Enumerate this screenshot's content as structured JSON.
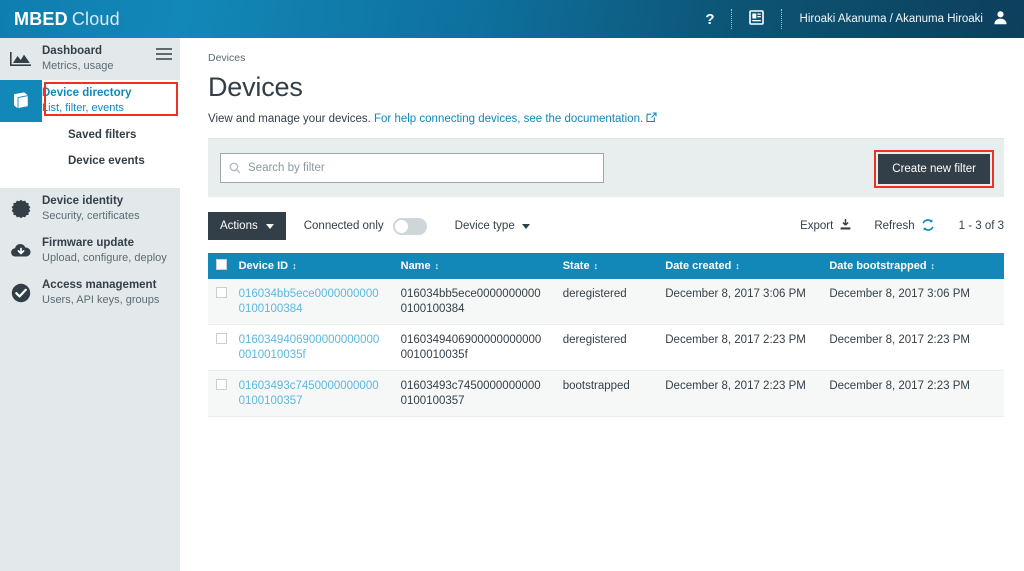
{
  "topbar": {
    "brand_bold": "MBED",
    "brand_light": "Cloud",
    "help_label": "?",
    "docs_icon": "book-contact-icon",
    "user_name": "Hiroaki Akanuma / Akanuma Hiroaki",
    "avatar_icon": "user-avatar-icon",
    "gradient_from": "#1288b8",
    "gradient_to": "#0c3f5c"
  },
  "sidebar": {
    "menu_icon": "hamburger-menu-icon",
    "items": [
      {
        "title": "Dashboard",
        "sub": "Metrics, usage",
        "icon": "chart-mountain-icon",
        "active": false
      },
      {
        "title": "Device directory",
        "sub": "List, filter, events",
        "icon": "book-icon",
        "active": true
      },
      {
        "title": "Device identity",
        "sub": "Security, certificates",
        "icon": "gear-badge-icon",
        "active": false
      },
      {
        "title": "Firmware update",
        "sub": "Upload, configure, deploy",
        "icon": "cloud-download-icon",
        "active": false
      },
      {
        "title": "Access management",
        "sub": "Users, API keys, groups",
        "icon": "check-circle-icon",
        "active": false
      }
    ],
    "sub_items": [
      {
        "label": "Saved filters"
      },
      {
        "label": "Device events"
      }
    ],
    "highlight_color": "#ee3124"
  },
  "main": {
    "breadcrumb": "Devices",
    "title": "Devices",
    "description_prefix": "View and manage your devices.",
    "description_link": "For help connecting devices, see the documentation.",
    "external_link_icon": "external-link-icon"
  },
  "filterbar": {
    "search_placeholder": "Search by filter",
    "search_value": "",
    "search_icon": "search-icon",
    "create_filter_label": "Create new filter",
    "highlight_color": "#ee3124"
  },
  "toolbar": {
    "actions_label": "Actions",
    "actions_caret_icon": "caret-down-icon",
    "connected_only_label": "Connected only",
    "connected_only_state": "off",
    "device_type_label": "Device type",
    "device_type_caret_icon": "caret-down-icon",
    "export_label": "Export",
    "export_icon": "download-icon",
    "refresh_label": "Refresh",
    "refresh_icon": "refresh-icon",
    "pagination_text": "1 - 3 of 3"
  },
  "table": {
    "select_all_icon": "checkbox-icon",
    "sort_icon": "sort-updown-icon",
    "columns": [
      {
        "label": "Device ID"
      },
      {
        "label": "Name"
      },
      {
        "label": "State"
      },
      {
        "label": "Date created"
      },
      {
        "label": "Date bootstrapped"
      }
    ],
    "rows": [
      {
        "device_id": "016034bb5ece00000000000100100384",
        "name": "016034bb5ece00000000000100100384",
        "state": "deregistered",
        "date_created": "December 8, 2017 3:06 PM",
        "date_bootstrapped": "December 8, 2017 3:06 PM"
      },
      {
        "device_id": "01603494069000000000000010010035f",
        "name": "01603494069000000000000010010035f",
        "state": "deregistered",
        "date_created": "December 8, 2017 2:23 PM",
        "date_bootstrapped": "December 8, 2017 2:23 PM"
      },
      {
        "device_id": "01603493c74500000000000100100357",
        "name": "01603493c74500000000000100100357",
        "state": "bootstrapped",
        "date_created": "December 8, 2017 2:23 PM",
        "date_bootstrapped": "December 8, 2017 2:23 PM"
      }
    ]
  }
}
